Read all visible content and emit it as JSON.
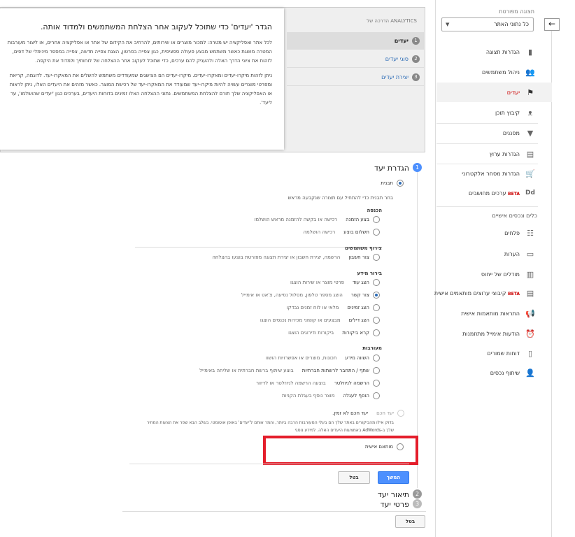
{
  "sidebar": {
    "back_symbol": "←",
    "view_label": "תצוגה מפורטת",
    "view_select": "כל נתוני האתר",
    "items": [
      {
        "label": "הגדרות תצוגה",
        "icon": "document-icon",
        "glyph": "▮"
      },
      {
        "label": "ניהול משתמשים",
        "icon": "users-icon",
        "glyph": "👥"
      },
      {
        "label": "יעדים",
        "icon": "flag-icon",
        "glyph": "⚑"
      },
      {
        "label": "קיבוץ תוכן",
        "icon": "person-walk-icon",
        "glyph": "ᴥ"
      },
      {
        "label": "מסננים",
        "icon": "filter-icon",
        "glyph": "▼"
      },
      {
        "label": "הגדרות ערוץ",
        "icon": "channel-icon",
        "glyph": "▤"
      },
      {
        "label": "הגדרות מסחר אלקטרוני",
        "icon": "cart-icon",
        "glyph": "🛒"
      },
      {
        "label": "ערכים מחושבים",
        "beta": "BETA",
        "icon": "dd-icon",
        "glyph": "Dd"
      }
    ],
    "personal_title": "כלים ונכסים אישיים",
    "personal_items": [
      {
        "label": "פלחים",
        "icon": "segments-icon",
        "glyph": "☷"
      },
      {
        "label": "הערות",
        "icon": "annotation-icon",
        "glyph": "▭"
      },
      {
        "label": "מודלים של ייחוס",
        "icon": "bar-chart-icon",
        "glyph": "▥"
      },
      {
        "label": "קיבוצי ערוצים מותאמים אישית",
        "beta": "BETA",
        "icon": "channel-group-icon",
        "glyph": "▤"
      },
      {
        "label": "התראות מותאמות אישית",
        "icon": "megaphone-icon",
        "glyph": "📢"
      },
      {
        "label": "הודעות אימייל מתוזמנות",
        "icon": "clock-icon",
        "glyph": "⏰"
      },
      {
        "label": "דוחות שמורים",
        "icon": "saved-report-icon",
        "glyph": "▯"
      },
      {
        "label": "שיתוף נכסים",
        "icon": "share-user-icon",
        "glyph": "👤"
      }
    ]
  },
  "help": {
    "header": "הדרכה של ANALYTICS",
    "title": "הגדר 'יעדים' כדי שתוכל לעקוב אחר הצלחת המשתמשים ולמדוד אותה.",
    "p1_lines": [
      "לכל אתר ואפליקציה יש מטרה: למכור מוצרים או שירותים, להרחיב את הקידום של אתר או אפליקציה אחרים, או ליצור מעורבות",
      "המטרה מושגת כאשר משתמש מבצע פעולה ספציפית, כגון צפייה בסרטון, הצגת צפייה חדשה, צפייה במספר מינימלי של דפים,",
      "לזהות את ציוני הדרך האלה ולהעניק להם ערכים, כדי שתוכל לעקוב אחר ההצלחה של לוחותיך ולמדוד את היקפה."
    ],
    "p2_lines": [
      "ניתן לזהות מיקרו-יעדים ומאקרו-יעדים. מיקרו-יעדים הם הצישגים שמעודדים משתמש להשלים את המאקרו-יעד. לדוגמה, קריאת",
      "ומפרטי מוצרים עשויה להיות מיקרו-יעד שמעודד את המאקרו-יעד של רכישת המוצר. כאשר מזהים את היעדים האלו, ניתן לראות",
      "או האפליקציה שלך תורם להצלחת המשתמשים. נתוני ההצלחה האלו זמינים בדוחות היעדים, בערכים כגון 'יעדים שהושלמו', ער",
      "ליעד'."
    ],
    "tabs": [
      {
        "num": "1",
        "label": "יעדים"
      },
      {
        "num": "2",
        "label": "סוגי יעדים"
      },
      {
        "num": "3",
        "label": "יצירת יעדים"
      }
    ]
  },
  "goal": {
    "step1": {
      "num": "1",
      "title": "הגדרת יעד"
    },
    "template_label": "תבנית",
    "template_desc": "בחר תבנית כדי להתחיל עם תצורה שנקבעה מראש",
    "groups": [
      {
        "title": "הכנסה",
        "options": [
          {
            "label": "בצע הזמנה",
            "desc": "רכישה או בקשה להזמנה מראש הושלמו"
          },
          {
            "label": "תשלום בוצע",
            "desc": "רכישה הושלמה"
          }
        ]
      },
      {
        "title": "צירוף משתמשים",
        "options": [
          {
            "label": "צור חשבון",
            "desc": "הרשמה, יצירת חשבון או יצירת תצוגה מפורטת בוצעו בהצלחה"
          }
        ]
      },
      {
        "title": "בירור מידע",
        "options": [
          {
            "label": "הצג עוד",
            "desc": "פרטי מוצר או שירות הוצגו"
          },
          {
            "label": "צור קשר",
            "desc": "הוצג מספר טלפון, מסלול נסיעה, צ'אט או אימייל"
          },
          {
            "label": "הצג זמינים",
            "desc": "מלאי או לוח זמנים נבדקו"
          },
          {
            "label": "הצג דילים",
            "desc": "מבצעים או קופוני מכירות נכנסים הוצגו"
          },
          {
            "label": "קרא ביקורות",
            "desc": "ביקורות ודירוגים הוצגו"
          }
        ]
      },
      {
        "title": "מעורבות",
        "options": [
          {
            "label": "השווה מידע",
            "desc": "תכונות, מוצרים או אפשרויות הושוו"
          },
          {
            "label": "שתף / התחבר לרשתות חברתיות",
            "desc": "בוצע שיתוף ברשת חברתית או שליחה באימייל"
          },
          {
            "label": "הרשמה לניוזלטר",
            "desc": "בוצעה הרשמה לניוזלטר או לדיוור"
          },
          {
            "label": "הוסף לעגלה",
            "desc": "מוצר נוסף בעגלת הקניות"
          }
        ]
      }
    ],
    "smart": {
      "label": "יעד חכם",
      "desc": "יעד חכם לא זמין."
    },
    "smart_lines": [
      "בדוק אילו מהביקורים באתר שלך הם בעלי המעורבות הרבה ביותר, והמר אותם ל'יעדים' באופן אוטומטי. בשלב הבא שפר את הצעות המחיר",
      "שלך ב-AdWords באמצעות היעדים האלה. למידע נוסף"
    ],
    "custom_label": "מותאם אישית",
    "continue_label": "המשך",
    "cancel_label": "בטל",
    "step2": {
      "num": "2",
      "title": "תיאור יעד"
    },
    "step3": {
      "num": "3",
      "title": "פרטי יעד"
    },
    "bottom_cancel": "בטל"
  }
}
